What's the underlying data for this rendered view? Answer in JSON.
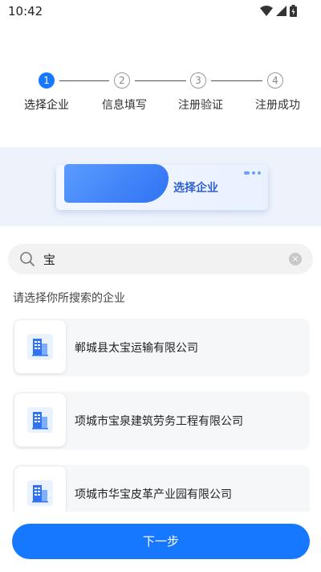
{
  "status_bar": {
    "time": "10:42"
  },
  "stepper": {
    "steps": [
      {
        "number": "1",
        "label": "选择企业"
      },
      {
        "number": "2",
        "label": "信息填写"
      },
      {
        "number": "3",
        "label": "注册验证"
      },
      {
        "number": "4",
        "label": "注册成功"
      }
    ],
    "active_index": 0
  },
  "banner": {
    "title": "选择企业"
  },
  "search": {
    "value": "宝",
    "clear_symbol": "×"
  },
  "hint": "请选择你所搜索的企业",
  "companies": [
    {
      "name": "郸城县太宝运输有限公司",
      "icon": "building-icon"
    },
    {
      "name": "项城市宝泉建筑劳务工程有限公司",
      "icon": "building-icon"
    },
    {
      "name": "项城市华宝皮革产业园有限公司",
      "icon": "building-icon"
    }
  ],
  "next_button": {
    "label": "下一步"
  },
  "colors": {
    "primary": "#1677ff",
    "banner_bg": "#eef3fb",
    "search_bg": "#f2f2f2"
  }
}
